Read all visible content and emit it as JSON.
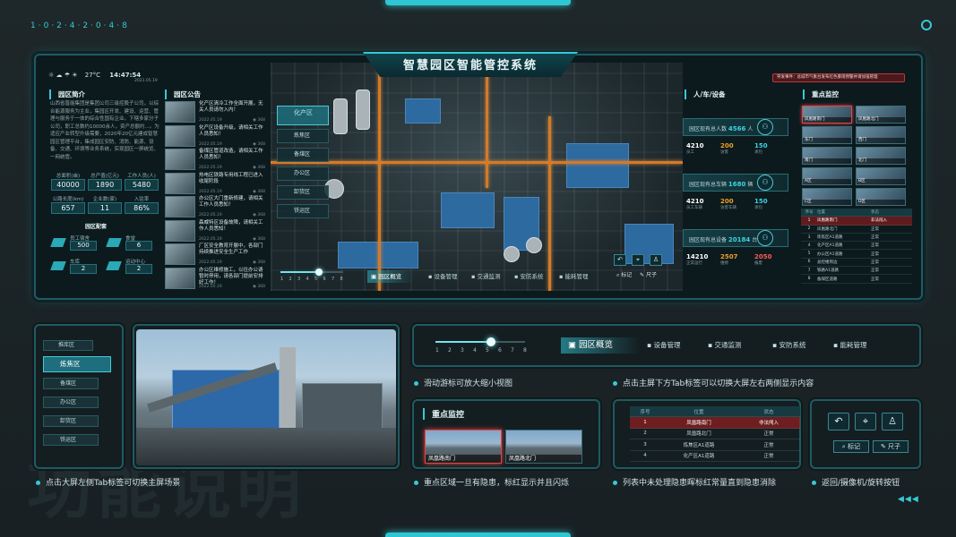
{
  "deco": {
    "code": "1·0·2·4·2·0·4·8",
    "arrows": "◀◀◀"
  },
  "screen": {
    "title": "智慧园区智能管控系统",
    "weather": {
      "temp": "27°C",
      "time": "14:47:54",
      "date": "2021.05.19"
    },
    "alert": "突发事件：总城市气象台发布红色暴雨预警并请加强管理",
    "intro": {
      "title": "园区简介",
      "text": "山西省晋能集团是集团公司三级控股子公司，以综合能源服务为主业，集园区开发、建设、运营、管理与服务于一体的综合性国有企业。下辖多家分子公司，职工总数约10000余人，资产总额约...。为适应产业转型升级需要，2020年20亿元建成智慧园区管理平台，集成园区安防、消防、能源、设备、交通、环境等业务系统，实现园区一屏统览、一网统管。",
      "stats": [
        {
          "label": "总面积(亩)",
          "value": "40000"
        },
        {
          "label": "总产值(亿元)",
          "value": "1890"
        },
        {
          "label": "工作人员(人)",
          "value": "5480"
        },
        {
          "label": "公路长度(km)",
          "value": "657"
        },
        {
          "label": "企业数(家)",
          "value": "11"
        },
        {
          "label": "入驻率",
          "value": "86%"
        }
      ],
      "sub_title": "园区配套",
      "facilities": [
        {
          "label": "员工宿舍",
          "value": "500"
        },
        {
          "label": "食堂",
          "value": "6"
        },
        {
          "label": "车库",
          "value": "2"
        },
        {
          "label": "运动中心",
          "value": "2"
        }
      ]
    },
    "notice": {
      "title": "园区公告",
      "items": [
        {
          "text": "化产区清冷工作全面开展，无关人员请勿入内！",
          "date": "2022.05.19",
          "heat": "368"
        },
        {
          "text": "化产区设备升级，请相关工作人员悉知！",
          "date": "2022.05.19",
          "heat": "368"
        },
        {
          "text": "备煤区管道改造，请相关工作人员悉知！",
          "date": "2022.05.19",
          "heat": "368"
        },
        {
          "text": "热电区铁路专用线工程已进入收尾阶段",
          "date": "2022.05.19",
          "heat": "368"
        },
        {
          "text": "办公区大门重新修建，请相关工作人员悉知！",
          "date": "2022.05.19",
          "heat": "368"
        },
        {
          "text": "森威特区设备故障，请相关工作人员悉知！",
          "date": "2022.05.19",
          "heat": "368"
        },
        {
          "text": "厂区安全教育开展中，各部门持续推进安全生产工作",
          "date": "2022.05.19",
          "heat": "368"
        },
        {
          "text": "办公区维修施工，以往办公请暂时停用，请各部门提前安排好工作！",
          "date": "2022.05.19",
          "heat": "368"
        }
      ]
    },
    "side_tabs": [
      "化产区",
      "炼焦区",
      "备煤区",
      "办公区",
      "卸货区",
      "铁运区"
    ],
    "bottom_tabs": [
      "园区概览",
      "设备管理",
      "交通监测",
      "安防系统",
      "能耗管理"
    ],
    "slider": {
      "ticks": [
        "1",
        "2",
        "3",
        "4",
        "5",
        "6",
        "7",
        "8"
      ],
      "level": 0.62
    },
    "tools": {
      "mark": "标记",
      "ruler": "尺子"
    },
    "people": {
      "title": "人/车/设备",
      "cards": [
        {
          "label": "园区现有总人数",
          "value": "4566",
          "unit": "人",
          "a": "4210",
          "b": "200",
          "c": "150",
          "la": "员工",
          "lb": "访客",
          "lc": "承包"
        },
        {
          "label": "园区现有总车辆",
          "value": "1680",
          "unit": "辆",
          "a": "4210",
          "b": "200",
          "c": "150",
          "la": "员工车辆",
          "lb": "访客车辆",
          "lc": "承包"
        },
        {
          "label": "园区现有总设备",
          "value": "20184",
          "unit": "台",
          "a": "14210",
          "b": "2507",
          "c": "2050",
          "la": "正常运行",
          "lb": "维修",
          "lc": "报废"
        }
      ]
    },
    "monitor": {
      "title": "重点监控",
      "cams": [
        "凤凰路南门",
        "凤凰路北门",
        "东门",
        "西门",
        "南门",
        "北门",
        "A区",
        "B区",
        "C区",
        "D区"
      ],
      "table": {
        "head": [
          "序号",
          "位置",
          "状态"
        ],
        "rows": [
          [
            "1",
            "凤凰路南门",
            "非法闯入"
          ],
          [
            "2",
            "凤凰路北门",
            "正常"
          ],
          [
            "3",
            "炼焦区A1道路",
            "正常"
          ],
          [
            "4",
            "化产区A1道路",
            "正常"
          ],
          [
            "5",
            "办公区A1道路",
            "正常"
          ],
          [
            "6",
            "总控楼周边",
            "正常"
          ],
          [
            "7",
            "铁路A1道路",
            "正常"
          ],
          [
            "8",
            "备煤区道路",
            "正常"
          ]
        ]
      }
    }
  },
  "lower": {
    "c1": "点击大屏左侧Tab标签可切换主屏场景",
    "c2": "滑动游标可放大缩小视图",
    "c3": "点击主屏下方Tab标签可以切换大屏左右两侧显示内容",
    "c4": "重点区域一旦有隐患，标红显示并且闪烁",
    "c5": "列表中未处理隐患晖标红常量直到隐患消除",
    "c6": "返回/摄像机/旋转按钮",
    "mini_tabs": [
      "炼焦区",
      "备煤区",
      "办公区",
      "卸货区",
      "铁运区"
    ],
    "mini_active": "炼焦区",
    "monitor_title": "重点监控",
    "cam1": "凤凰路南门",
    "cam2": "凤凰路北门",
    "list": {
      "head": [
        "序号",
        "位置",
        "状态"
      ],
      "rows": [
        [
          "1",
          "凤凰路南门",
          "非法闯入"
        ],
        [
          "2",
          "凤凰路北门",
          "正常"
        ],
        [
          "3",
          "炼焦区A1道路",
          "正常"
        ],
        [
          "4",
          "化产区A1道路",
          "正常"
        ]
      ]
    },
    "tabs": [
      "园区概览",
      "设备管理",
      "交通监测",
      "安防系统",
      "能耗管理"
    ],
    "slider_ticks": [
      "1",
      "2",
      "3",
      "4",
      "5",
      "6",
      "7",
      "8"
    ],
    "slider_level": 0.62,
    "mark": "标记",
    "ruler": "尺子"
  },
  "watermark": "功能说明",
  "colors": {
    "accent": "#38c9d6",
    "alert": "#e24545",
    "orange": "#f0a020"
  }
}
